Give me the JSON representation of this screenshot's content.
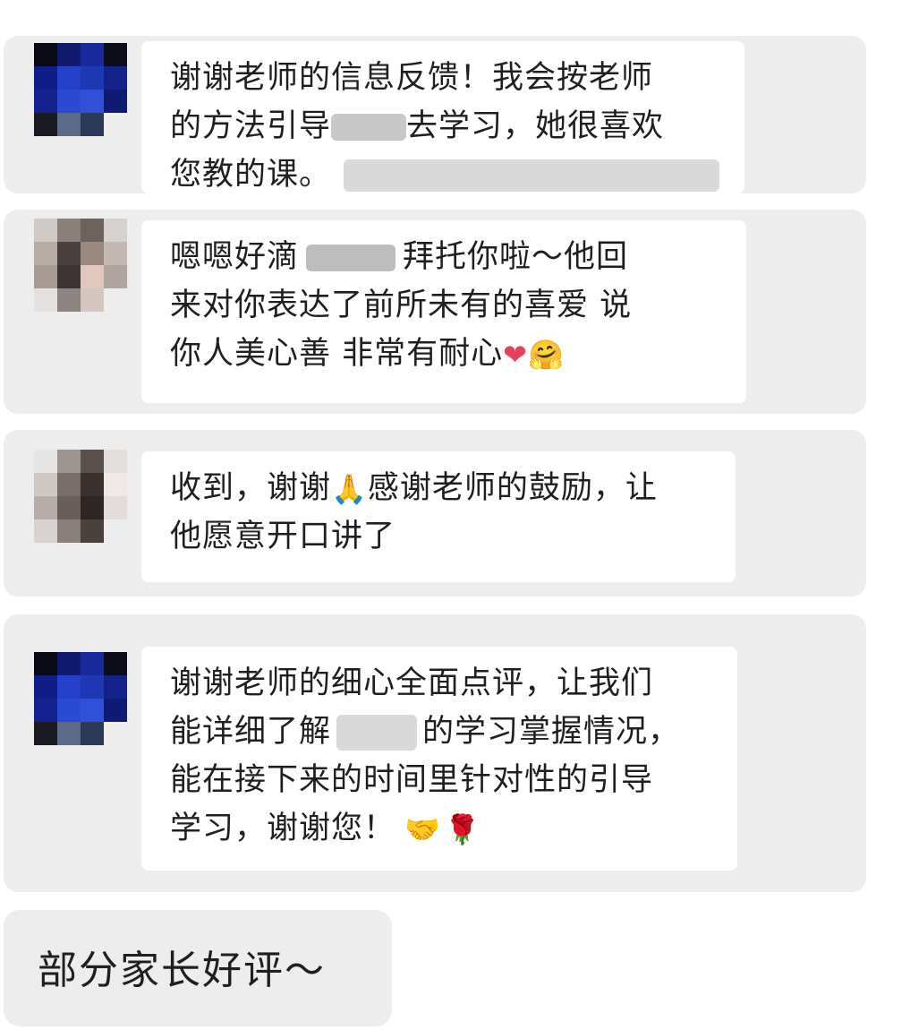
{
  "messages": [
    {
      "lines": [
        {
          "text": "谢谢老师的信息反馈！我会按老师"
        },
        {
          "pre": "的方法引导",
          "post": "去学习，她很喜欢"
        },
        {
          "text": "您教的课。"
        }
      ]
    },
    {
      "lines": [
        {
          "pre": "嗯嗯好滴",
          "post": "拜托你啦～他回"
        },
        {
          "text": "来对你表达了前所未有的喜爱 说"
        },
        {
          "text": "你人美心善 非常有耐心"
        }
      ],
      "emojis": {
        "heart": "❤",
        "hug": "🤗"
      }
    },
    {
      "lines": [
        {
          "pre": "收到，谢谢",
          "post": "感谢老师的鼓励，让"
        },
        {
          "text": "他愿意开口讲了"
        }
      ],
      "emojis": {
        "pray": "🙏"
      }
    },
    {
      "lines": [
        {
          "text": "谢谢老师的细心全面点评，让我们"
        },
        {
          "pre": "能详细了解",
          "post": "的学习掌握情况，"
        },
        {
          "text": "能在接下来的时间里针对性的引导"
        },
        {
          "text": "学习，谢谢您！"
        }
      ],
      "emojis": {
        "handshake": "🤝",
        "rose": "🌹"
      }
    }
  ],
  "caption": "部分家长好评～"
}
